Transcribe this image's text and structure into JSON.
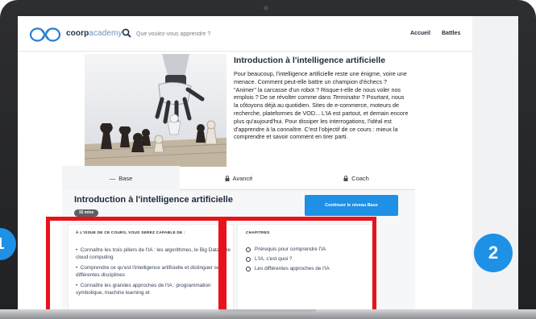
{
  "header": {
    "logo_brand": "coorp",
    "logo_suffix": "academy",
    "search_placeholder": "Que voulez-vous apprendre ?",
    "nav": [
      "Accueil",
      "Battles"
    ]
  },
  "course": {
    "title": "Introduction à l'intelligence artificielle",
    "description": [
      "Pour beaucoup, l'intelligence artificielle reste une énigme, voire une menace. Comment peut-elle battre un champion d'échecs ? \"Animer\" la carcasse d'un robot ? Risque-t-elle de nous voler nos emplois ? De se révolter comme dans ",
      "Terminator",
      " ? Pourtant, nous la côtoyons déjà au quotidien. Sites de e-commerce, moteurs de recherche, plateformes de VOD... L'IA est partout, et demain encore plus qu'aujourd'hui. Pour dissiper les interrogations, l'idéal est d'apprendre à la connaître. C'est l'objectif de ce cours : mieux la comprendre et savoir comment en tirer parti."
    ]
  },
  "tabs": [
    {
      "label": "Base",
      "icon": "dash-icon",
      "active": true
    },
    {
      "label": "Avancé",
      "icon": "lock-icon",
      "active": false
    },
    {
      "label": "Coach",
      "icon": "lock-icon",
      "active": false
    }
  ],
  "level": {
    "title": "Introduction à l'intelligence artificielle",
    "duration": "15 mins",
    "continue_label": "Continuer le niveau Base",
    "goals_heading": "À L'ISSUE DE CE COURS, VOUS SEREZ CAPABLE DE :",
    "goals": [
      "Connaître les trois piliers de l'IA : les algorithmes, le Big Data et le cloud computing",
      "Comprendre ce qu'est l'intelligence artificielle et distinguer ses différentes disciplines",
      "Connaître les grandes approches de l'IA : programmation symbolique, machine learning et"
    ],
    "chapters_heading": "CHAPITRES",
    "chapters": [
      "Prérequis pour comprendre l'IA",
      "L'IA, c'est quoi ?",
      "Les différentes approches de l'IA"
    ]
  },
  "annotations": {
    "bubble_1": "1",
    "bubble_2": "2",
    "highlight_color": "#e8121b",
    "bubble_color": "#1e90e6"
  }
}
